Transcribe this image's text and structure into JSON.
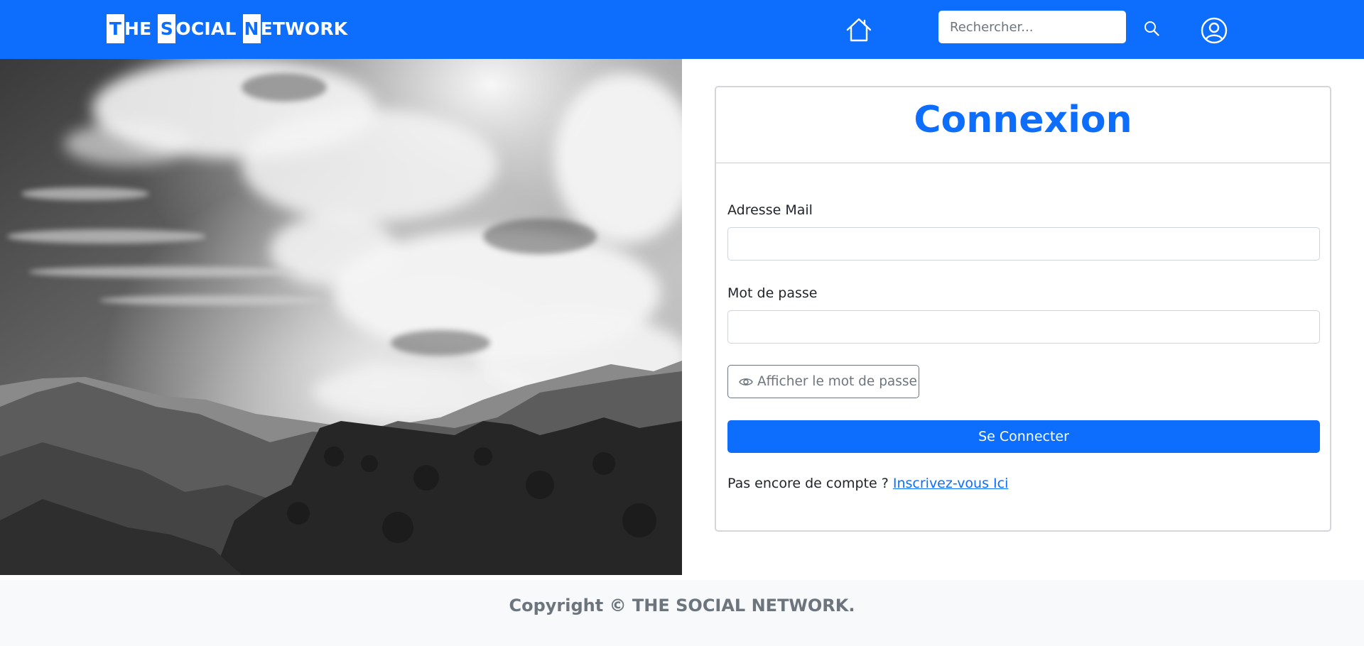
{
  "navbar": {
    "brand": {
      "words": [
        {
          "cap": "T",
          "rest": "HE"
        },
        {
          "cap": "S",
          "rest": "OCIAL"
        },
        {
          "cap": "N",
          "rest": "ETWORK"
        }
      ]
    },
    "home_icon": "home-icon",
    "search": {
      "placeholder": "Rechercher...",
      "value": ""
    },
    "search_icon": "search-icon",
    "user_icon": "user-circle-icon",
    "color": "#0d6efd"
  },
  "hero": {
    "image": "black-and-white mountains under clouds photo"
  },
  "login": {
    "title": "Connexion",
    "email_label": "Adresse Mail",
    "email_value": "",
    "password_label": "Mot de passe",
    "password_value": "",
    "show_password_label": "Afficher le mot de passe",
    "show_password_icon": "eye-icon",
    "submit_label": "Se Connecter",
    "signup_prompt": "Pas encore de compte ?",
    "signup_link": "Inscrivez-vous Ici"
  },
  "footer": {
    "copyright": "Copyright © THE SOCIAL NETWORK."
  },
  "colors": {
    "primary": "#0d6efd",
    "footer_bg": "#f8f9fa",
    "footer_text": "#6c757d"
  }
}
